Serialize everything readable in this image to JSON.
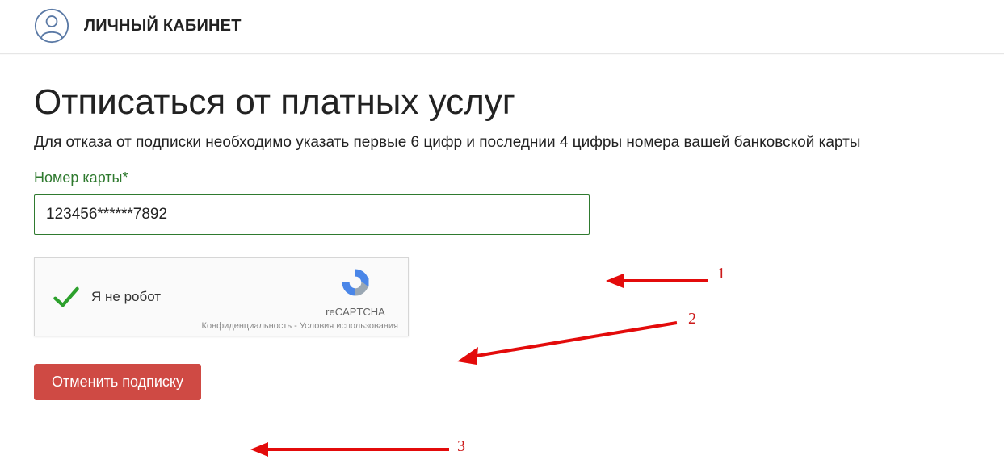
{
  "header": {
    "title": "ЛИЧНЫЙ КАБИНЕТ"
  },
  "page": {
    "heading": "Отписаться от платных услуг",
    "subtitle": "Для отказа от подписки необходимо указать первые 6 цифр и последнии 4 цифры номера вашей банковской карты"
  },
  "card_field": {
    "label": "Номер карты*",
    "value": "123456******7892"
  },
  "captcha": {
    "label": "Я не робот",
    "brand": "reCAPTCHA",
    "privacy": "Конфиденциальность",
    "sep": " - ",
    "terms": "Условия использования"
  },
  "submit": {
    "label": "Отменить подписку"
  },
  "annotations": {
    "a1": "1",
    "a2": "2",
    "a3": "3"
  }
}
